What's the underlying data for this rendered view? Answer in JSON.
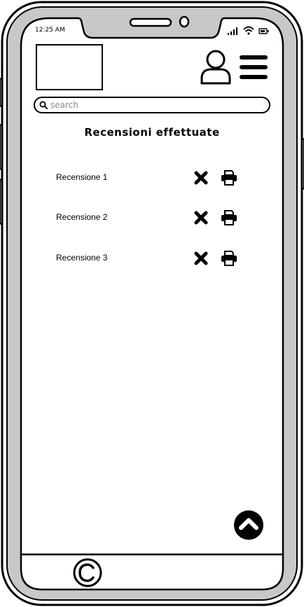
{
  "status_bar": {
    "time": "12:25 AM"
  },
  "header": {
    "logo": "image-placeholder",
    "user_icon": "user-icon",
    "menu_icon": "hamburger-menu-icon"
  },
  "search": {
    "placeholder": "search",
    "value": ""
  },
  "main": {
    "title": "Recensioni effettuate",
    "reviews": [
      {
        "label": "Recensione 1"
      },
      {
        "label": "Recensione 2"
      },
      {
        "label": "Recensione 3"
      }
    ]
  },
  "footer": {
    "copyright_icon": "copyright-icon"
  },
  "colors": {
    "ink": "#000000",
    "device_body": "#c8c8c8",
    "screen": "#ffffff"
  }
}
